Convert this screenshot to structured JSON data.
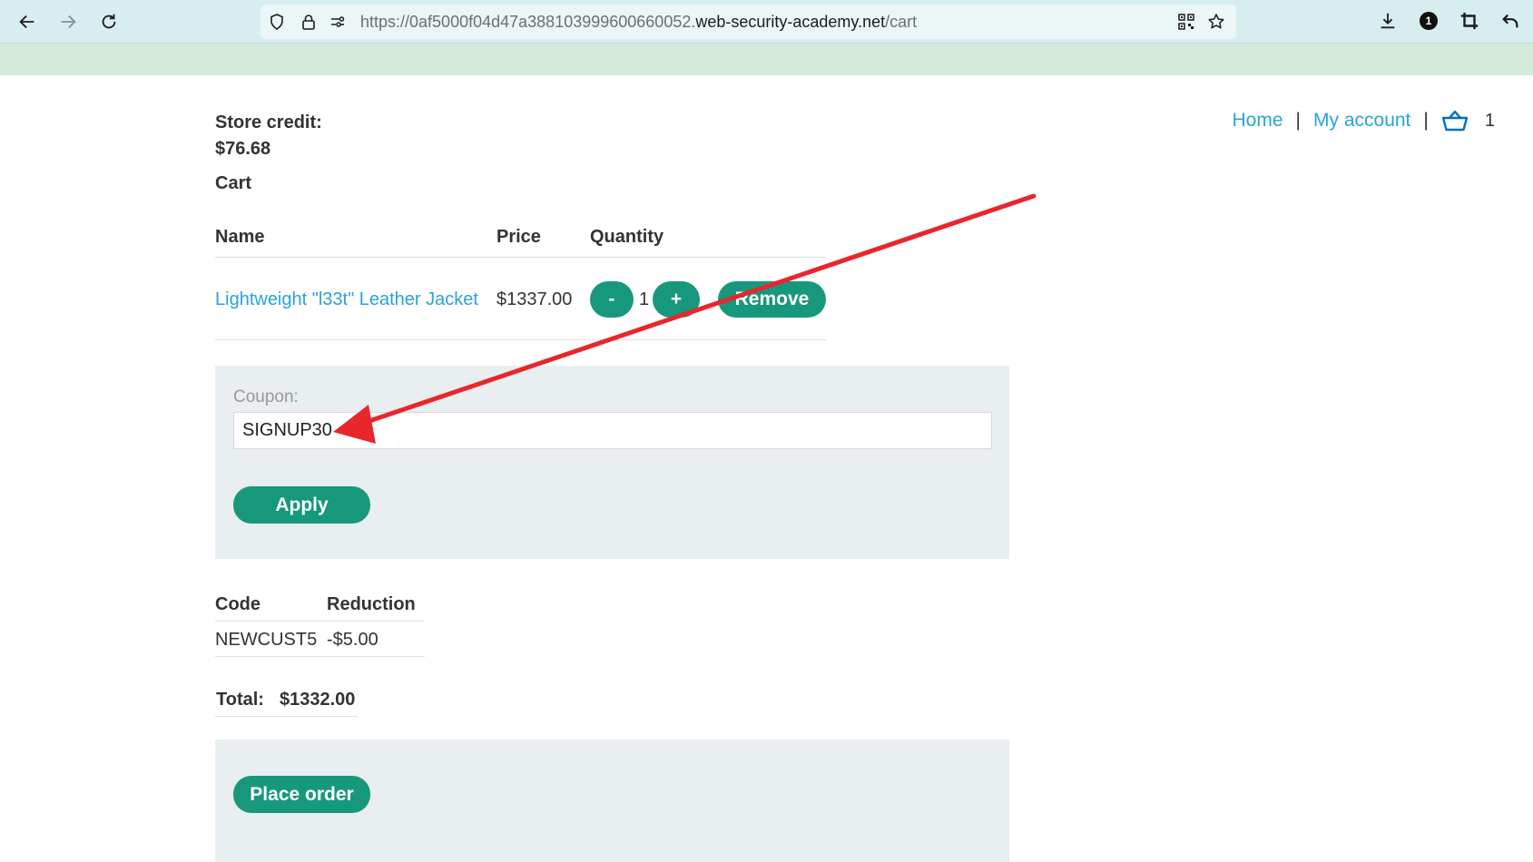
{
  "browser": {
    "url_prefix": "https://0af5000f04d47a388103999600660052.",
    "url_host": "web-security-academy.net",
    "url_path": "/cart",
    "extension_badge": "1"
  },
  "store_credit": {
    "label": "Store credit:",
    "value": "$76.68"
  },
  "nav": {
    "home": "Home",
    "separator": "|",
    "my_account": "My account",
    "cart_count": "1"
  },
  "cart": {
    "heading": "Cart",
    "columns": [
      "Name",
      "Price",
      "Quantity"
    ],
    "items": [
      {
        "name": "Lightweight \"l33t\" Leather Jacket",
        "price": "$1337.00",
        "quantity": "1",
        "minus_label": "-",
        "plus_label": "+",
        "remove_label": "Remove"
      }
    ]
  },
  "coupon": {
    "label": "Coupon:",
    "value": "SIGNUP30",
    "apply_label": "Apply"
  },
  "reductions": {
    "columns": [
      "Code",
      "Reduction"
    ],
    "rows": [
      {
        "code": "NEWCUST5",
        "reduction": "-$5.00"
      }
    ]
  },
  "total": {
    "label": "Total:",
    "value": "$1332.00"
  },
  "place_order_label": "Place order",
  "colors": {
    "accent_green": "#17987c",
    "link_blue": "#29a3d6",
    "panel_gray": "#e9eef0",
    "annotation_red": "#e8262c"
  }
}
